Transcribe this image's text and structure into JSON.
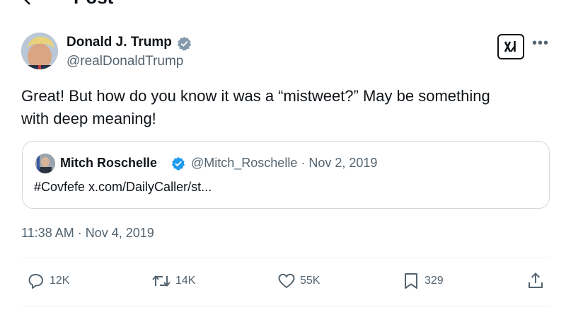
{
  "header": {
    "title": "Post"
  },
  "post": {
    "author_name": "Donald J. Trump",
    "author_handle": "@realDonaldTrump",
    "text_line1": "Great! But how do you know it was a “mistweet?” May be something",
    "text_line2": "with deep meaning!",
    "timestamp": "11:38 AM · Nov 4, 2019"
  },
  "quote": {
    "author_name": "Mitch Roschelle",
    "meta": "@Mitch_Roschelle · Nov 2, 2019",
    "text": "#Covfefe x.com/DailyCaller/st..."
  },
  "actions": {
    "replies": "12K",
    "reposts": "14K",
    "likes": "55K",
    "bookmarks": "329"
  },
  "icons": {
    "back": "arrow-left-icon",
    "verified": "verified-badge-icon",
    "grok": "grok-icon",
    "more": "more-icon",
    "reply": "reply-icon",
    "repost": "repost-icon",
    "like": "heart-icon",
    "bookmark": "bookmark-icon",
    "share": "share-icon"
  },
  "colors": {
    "verified": "#1d9bf0",
    "secondary_text": "#536471",
    "border": "#cfd9de"
  }
}
